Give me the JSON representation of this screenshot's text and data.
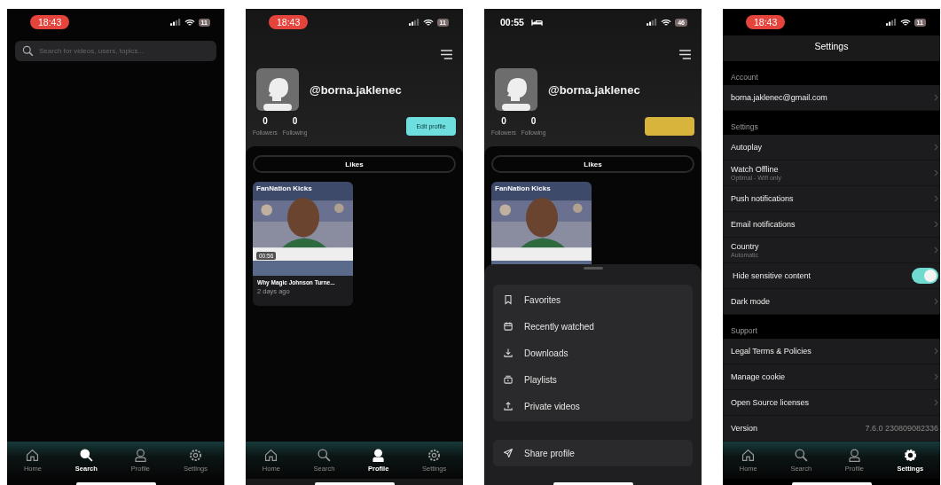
{
  "screens": [
    {
      "kind": "search",
      "status_bar": {
        "time": "18:43",
        "time_pill": true,
        "battery": "11"
      },
      "search_field": {
        "placeholder": "Search for videos, users, topics..."
      },
      "tab_bar": [
        {
          "label": "Home",
          "selected": false
        },
        {
          "label": "Search",
          "selected": true
        },
        {
          "label": "Profile",
          "selected": false
        },
        {
          "label": "Settings",
          "selected": false
        }
      ]
    },
    {
      "kind": "profile",
      "status_bar": {
        "time": "18:43",
        "time_pill": true,
        "battery": "11"
      },
      "username": "@borna.jaklenec",
      "stats": [
        {
          "value": "0",
          "label": "Followers"
        },
        {
          "value": "0",
          "label": "Following"
        }
      ],
      "edit_button": {
        "label": "Edit profile",
        "pressed": false
      },
      "tabs": [
        {
          "label": "Likes",
          "selected": true
        }
      ],
      "videos": [
        {
          "channel": "FanNation Kicks",
          "duration": "00:56",
          "title": "Why Magic Johnson Turne...",
          "age": "2 days ago"
        }
      ],
      "tab_bar": [
        {
          "label": "Home",
          "selected": false
        },
        {
          "label": "Search",
          "selected": false
        },
        {
          "label": "Profile",
          "selected": true
        },
        {
          "label": "Settings",
          "selected": false
        }
      ]
    },
    {
      "kind": "profile",
      "status_bar": {
        "time": "00:55",
        "time_pill": false,
        "sleep_mode": true,
        "battery": "46"
      },
      "username": "@borna.jaklenec",
      "stats": [
        {
          "value": "0",
          "label": "Followers"
        },
        {
          "value": "0",
          "label": "Following"
        }
      ],
      "edit_button": {
        "pressed": true
      },
      "tabs": [
        {
          "label": "Likes",
          "selected": true
        }
      ],
      "videos": [
        {
          "channel": "FanNation Kicks"
        }
      ],
      "sheet": {
        "items": [
          {
            "label": "Favorites"
          },
          {
            "label": "Recently watched"
          },
          {
            "label": "Downloads"
          },
          {
            "label": "Playlists"
          },
          {
            "label": "Private videos"
          }
        ],
        "actions": [
          {
            "label": "Share profile"
          }
        ]
      }
    },
    {
      "kind": "settings",
      "status_bar": {
        "time": "18:43",
        "time_pill": true,
        "battery": "11"
      },
      "title": "Settings",
      "sections": [
        {
          "heading": "Account",
          "rows": [
            {
              "kind": "link",
              "label": "borna.jaklenec@gmail.com"
            }
          ]
        },
        {
          "heading": "Settings",
          "rows": [
            {
              "kind": "link",
              "label": "Autoplay"
            },
            {
              "kind": "link",
              "label": "Watch Offline",
              "detail": "Optimal - Wifi only"
            },
            {
              "kind": "link",
              "label": "Push notifications"
            },
            {
              "kind": "link",
              "label": "Email notifications"
            },
            {
              "kind": "link",
              "label": "Country",
              "detail": "Automatic"
            },
            {
              "kind": "toggle",
              "label": "Hide sensitive content",
              "on": true
            },
            {
              "kind": "link",
              "label": "Dark mode"
            }
          ]
        },
        {
          "heading": "Support",
          "rows": [
            {
              "kind": "link",
              "label": "Legal Terms & Policies"
            },
            {
              "kind": "link",
              "label": "Manage cookie"
            },
            {
              "kind": "link",
              "label": "Open Source licenses"
            },
            {
              "kind": "value",
              "label": "Version",
              "value": "7.6.0 230809082336"
            }
          ]
        }
      ],
      "tab_bar": [
        {
          "label": "Home",
          "selected": false
        },
        {
          "label": "Search",
          "selected": false
        },
        {
          "label": "Profile",
          "selected": false
        },
        {
          "label": "Settings",
          "selected": true
        }
      ]
    }
  ]
}
